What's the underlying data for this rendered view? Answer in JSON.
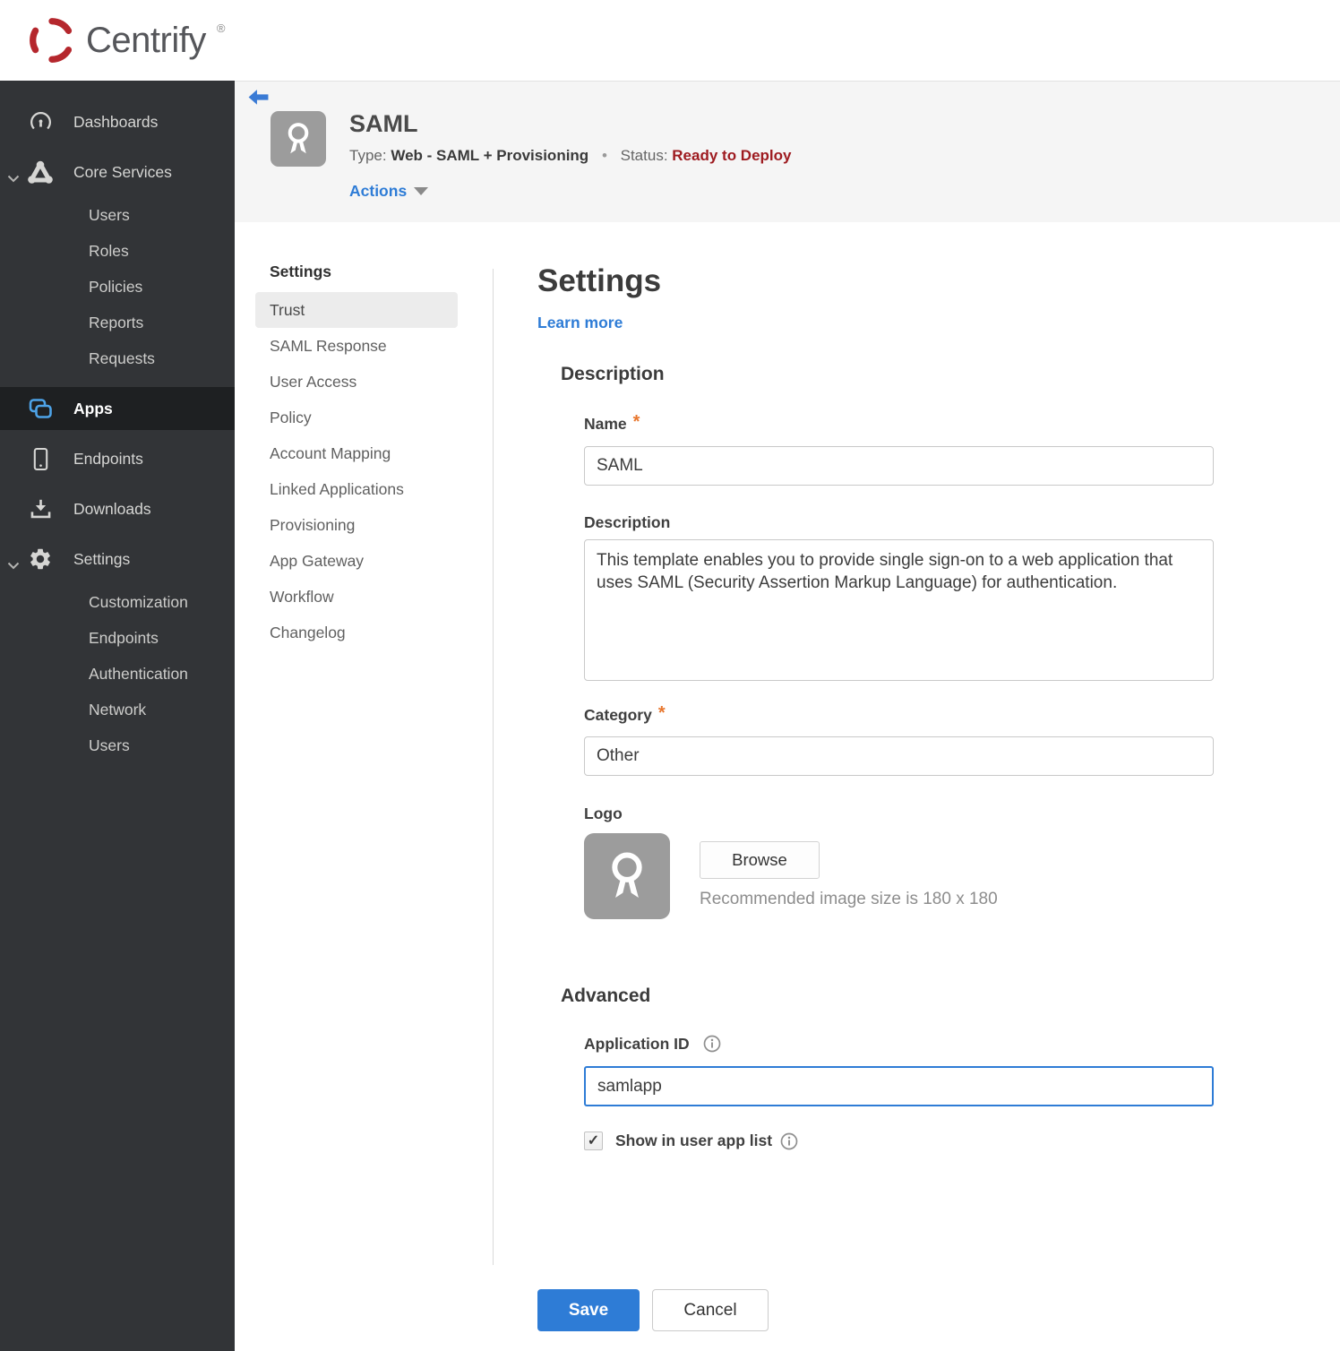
{
  "brand": {
    "name": "Centrify",
    "registered": "®"
  },
  "colors": {
    "accent_blue": "#2e7cd6",
    "status_red": "#9e1b20",
    "required_orange": "#e8772e",
    "sidebar_bg": "#323437",
    "sidebar_active_bg": "#1e2022",
    "header_bg": "#f5f5f5"
  },
  "icons": {
    "check": "✓"
  },
  "sidebar": {
    "dashboards": "Dashboards",
    "core_services": "Core Services",
    "core_children": [
      "Users",
      "Roles",
      "Policies",
      "Reports",
      "Requests"
    ],
    "apps": "Apps",
    "endpoints": "Endpoints",
    "downloads": "Downloads",
    "settings": "Settings",
    "settings_children": [
      "Customization",
      "Endpoints",
      "Authentication",
      "Network",
      "Users"
    ]
  },
  "app_header": {
    "title": "SAML",
    "type_label": "Type:",
    "type_value": "Web - SAML + Provisioning",
    "separator": "•",
    "status_label": "Status:",
    "status_value": "Ready to Deploy",
    "actions_label": "Actions"
  },
  "subnav": {
    "heading": "Settings",
    "selected": "Trust",
    "items": [
      "Trust",
      "SAML Response",
      "User Access",
      "Policy",
      "Account Mapping",
      "Linked Applications",
      "Provisioning",
      "App Gateway",
      "Workflow",
      "Changelog"
    ]
  },
  "main": {
    "title": "Settings",
    "learn_more": "Learn more",
    "required_marker": "*",
    "description_section": {
      "heading": "Description",
      "name_label": "Name",
      "name_value": "SAML",
      "description_label": "Description",
      "description_value": "This template enables you to provide single sign-on to a web application that uses SAML (Security Assertion Markup Language) for authentication.",
      "category_label": "Category",
      "category_value": "Other",
      "logo_label": "Logo",
      "browse_label": "Browse",
      "logo_hint": "Recommended image size is 180 x 180"
    },
    "advanced_section": {
      "heading": "Advanced",
      "application_id_label": "Application ID",
      "application_id_value": "samlapp",
      "show_in_user_app_list_label": "Show in user app list",
      "checkbox_checked": true
    },
    "save_label": "Save",
    "cancel_label": "Cancel"
  }
}
